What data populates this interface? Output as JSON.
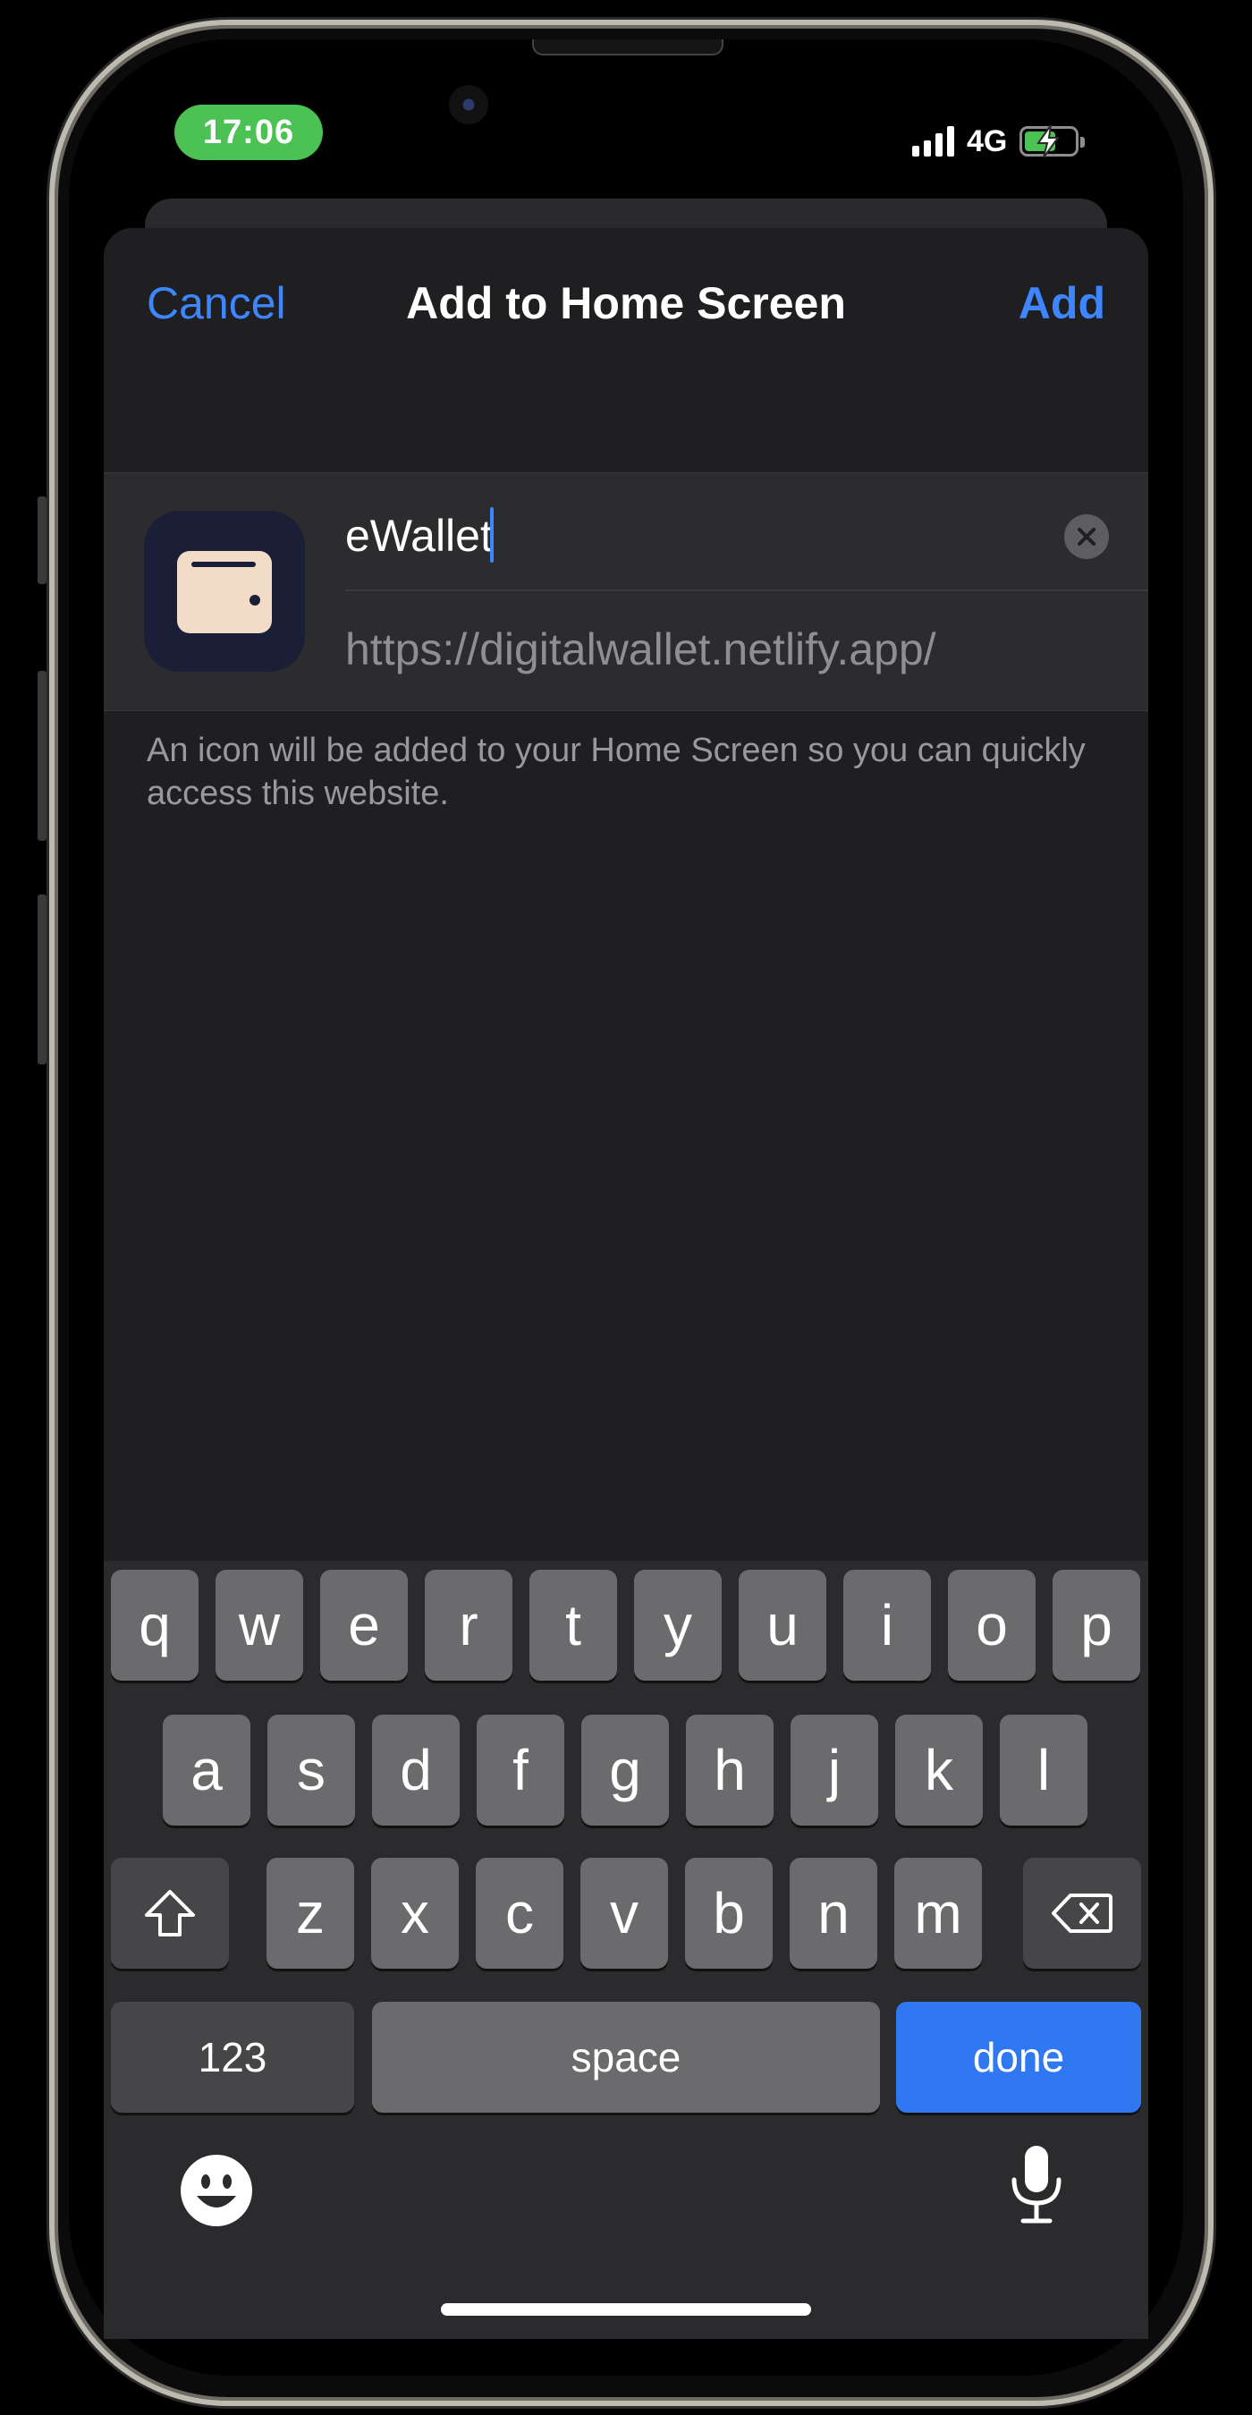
{
  "status_bar": {
    "time": "17:06",
    "network": "4G",
    "battery_charging": true
  },
  "nav": {
    "cancel_label": "Cancel",
    "title": "Add to Home Screen",
    "add_label": "Add"
  },
  "form": {
    "name_value": "eWallet",
    "url": "https://digitalwallet.netlify.app/",
    "helper_text": "An icon will be added to your Home Screen so you can quickly access this website."
  },
  "app_icon": {
    "name": "wallet-icon",
    "background": "#1a1e36",
    "glyph_color": "#f2dcc8"
  },
  "keyboard": {
    "row1": [
      "q",
      "w",
      "e",
      "r",
      "t",
      "y",
      "u",
      "i",
      "o",
      "p"
    ],
    "row2": [
      "a",
      "s",
      "d",
      "f",
      "g",
      "h",
      "j",
      "k",
      "l"
    ],
    "row3": [
      "z",
      "x",
      "c",
      "v",
      "b",
      "n",
      "m"
    ],
    "numbers_label": "123",
    "space_label": "space",
    "done_label": "done"
  },
  "colors": {
    "accent": "#3d86ff",
    "sheet_bg": "#1f1f21",
    "done_key": "#2f78f2",
    "time_pill": "#4cc154"
  }
}
